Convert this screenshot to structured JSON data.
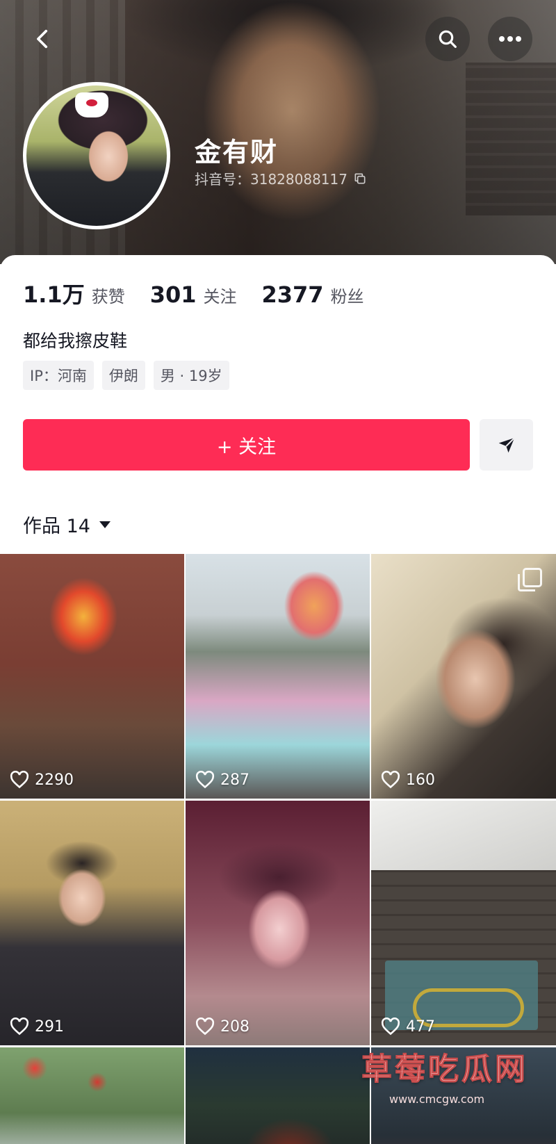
{
  "header": {
    "username": "金有财",
    "douyin_id": "抖音号：31828088117"
  },
  "stats": [
    {
      "value": "1.1万",
      "label": "获赞"
    },
    {
      "value": "301",
      "label": "关注"
    },
    {
      "value": "2377",
      "label": "粉丝"
    }
  ],
  "bio": "都给我擦皮鞋",
  "tags": [
    "IP：河南",
    "伊朗",
    "男 · 19岁"
  ],
  "actions": {
    "follow_label": "+ 关注"
  },
  "works": {
    "tab_label": "作品 14"
  },
  "videos": [
    {
      "likes": "2290"
    },
    {
      "likes": "287"
    },
    {
      "likes": "160"
    },
    {
      "likes": "291"
    },
    {
      "likes": "208"
    },
    {
      "likes": "477"
    },
    {
      "likes": ""
    },
    {
      "likes": ""
    },
    {
      "likes": ""
    }
  ],
  "watermark": {
    "title": "草莓吃瓜网",
    "url": "www.cmcgw.com"
  },
  "colors": {
    "accent": "#fe2c55",
    "text": "#161823",
    "secondary_text": "#555660",
    "tag_bg": "#f2f2f4"
  },
  "icons": [
    "back-icon",
    "search-icon",
    "more-icon",
    "copy-icon",
    "share-icon",
    "dropdown-icon",
    "heart-icon",
    "multi-image-icon"
  ]
}
